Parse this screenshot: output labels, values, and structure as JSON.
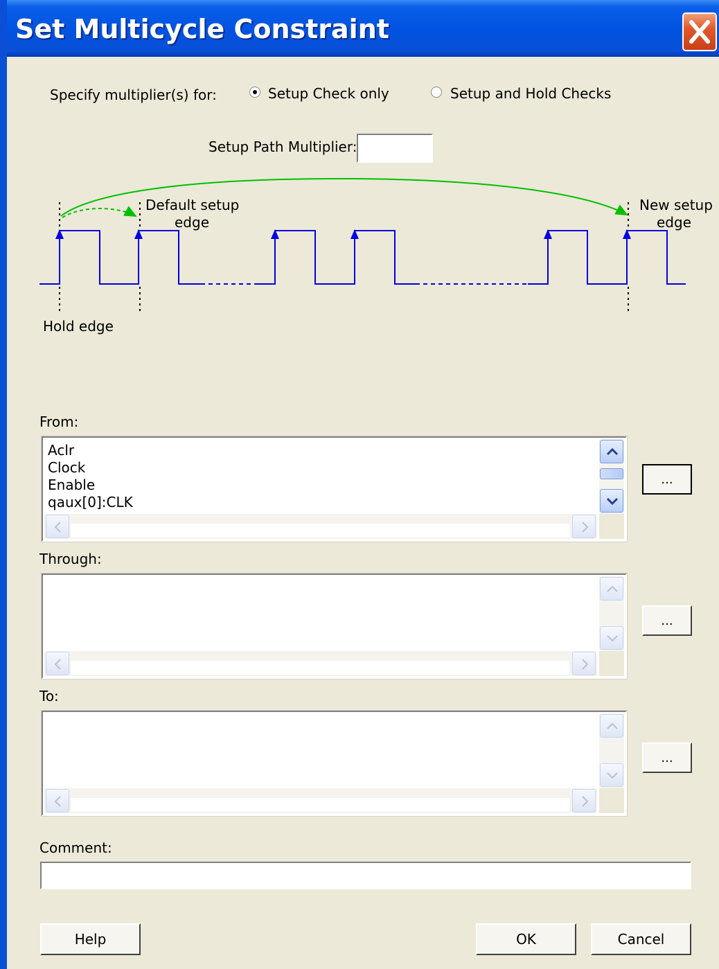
{
  "window": {
    "title": "Set Multicycle Constraint",
    "close_icon": "close-icon"
  },
  "multiplier": {
    "label": "Specify multiplier(s) for:",
    "options": [
      {
        "label": "Setup Check only",
        "selected": true
      },
      {
        "label": "Setup and Hold Checks",
        "selected": false
      }
    ],
    "setup_path_label": "Setup Path Multiplier:",
    "setup_path_value": ""
  },
  "diagram": {
    "default_setup_label_1": "Default setup",
    "default_setup_label_2": "edge",
    "new_setup_label_1": "New setup",
    "new_setup_label_2": "edge",
    "hold_label": "Hold edge",
    "colors": {
      "clock": "#0000e0",
      "arrow": "#00c000",
      "marker": "#000000"
    }
  },
  "from": {
    "label": "From:",
    "items": [
      "Aclr",
      "Clock",
      "Enable",
      "qaux[0]:CLK"
    ],
    "browse_label": "..."
  },
  "through": {
    "label": "Through:",
    "items": [],
    "browse_label": "..."
  },
  "to": {
    "label": "To:",
    "items": [],
    "browse_label": "..."
  },
  "comment": {
    "label": "Comment:",
    "value": ""
  },
  "buttons": {
    "help": "Help",
    "ok": "OK",
    "cancel": "Cancel"
  }
}
